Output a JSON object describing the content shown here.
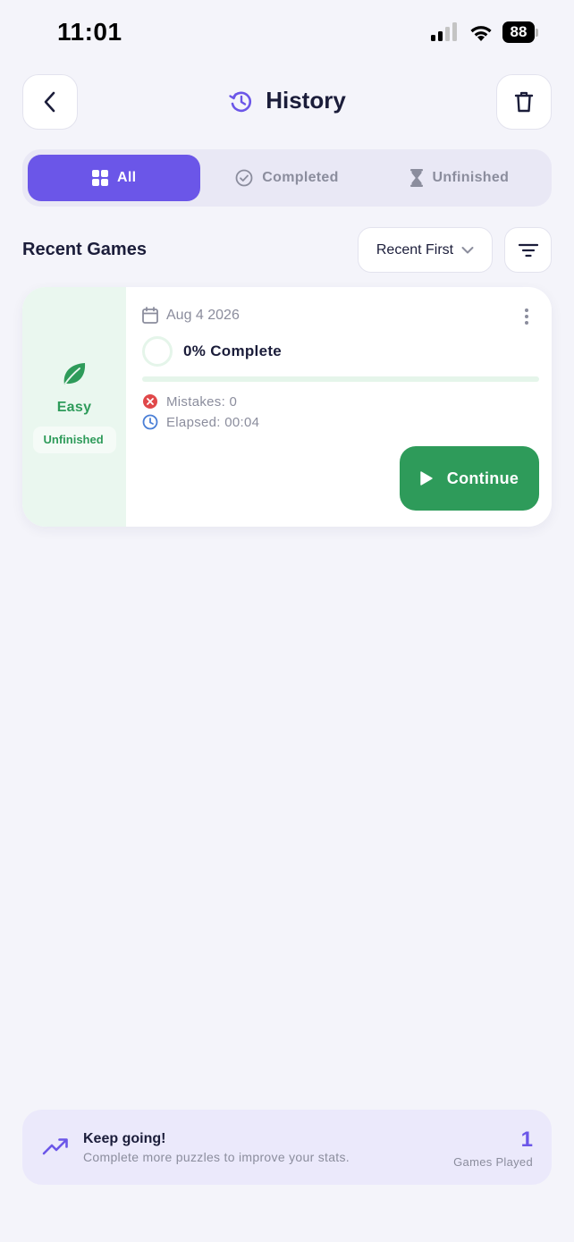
{
  "status_bar": {
    "time": "11:01",
    "battery": "88"
  },
  "header": {
    "title": "History",
    "icons": {
      "back": "chevron-left-icon",
      "title": "history-icon",
      "delete": "trash-icon"
    }
  },
  "tabs": [
    {
      "label": "All",
      "icon": "grid-icon",
      "active": true
    },
    {
      "label": "Completed",
      "icon": "check-circle-icon",
      "active": false
    },
    {
      "label": "Unfinished",
      "icon": "hourglass-icon",
      "active": false
    }
  ],
  "section": {
    "title": "Recent Games",
    "sort_label": "Recent First",
    "filter_icon": "filter-icon"
  },
  "games": [
    {
      "difficulty": "Easy",
      "status": "Unfinished",
      "date": "Aug 4 2026",
      "progress_label": "0% Complete",
      "progress": 0,
      "mistakes": "Mistakes: 0",
      "elapsed": "Elapsed: 00:04",
      "action_label": "Continue"
    }
  ],
  "banner": {
    "title": "Keep going!",
    "subtitle": "Complete more puzzles to improve your stats.",
    "count": "1",
    "count_label": "Games Played"
  },
  "colors": {
    "accent": "#6b56e8",
    "success": "#2e9b5a",
    "background": "#f4f4fa",
    "danger": "#e0484a",
    "info": "#4a7fd6"
  }
}
